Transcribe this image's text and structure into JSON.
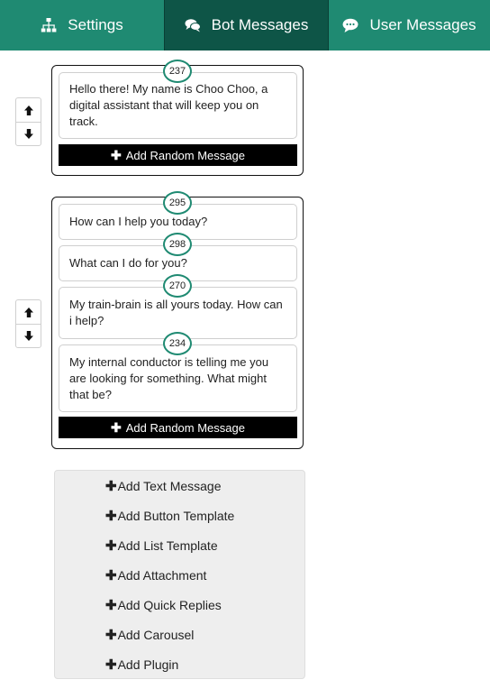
{
  "tabs": [
    {
      "label": "Settings",
      "icon": "sitemap-icon"
    },
    {
      "label": "Bot Messages",
      "icon": "comments-icon"
    },
    {
      "label": "User Messages",
      "icon": "comment-icon"
    }
  ],
  "active_tab": "Bot Messages",
  "groups": [
    {
      "messages": [
        {
          "id": "237",
          "text": "Hello there! My name is Choo Choo, a digital assistant that will keep you on track."
        }
      ],
      "add_random_label": "Add Random Message"
    },
    {
      "messages": [
        {
          "id": "295",
          "text": "How can I help you today?"
        },
        {
          "id": "298",
          "text": "What can I do for you?"
        },
        {
          "id": "270",
          "text": "My train-brain is all yours today. How can i help?"
        },
        {
          "id": "234",
          "text": "My internal conductor is telling me you are looking for something. What might that be?"
        }
      ],
      "add_random_label": "Add Random Message"
    }
  ],
  "add_menu": {
    "items": [
      "Add Text Message",
      "Add Button Template",
      "Add List Template",
      "Add Attachment",
      "Add Quick Replies",
      "Add Carousel",
      "Add Plugin"
    ]
  },
  "colors": {
    "tab": "#1f8a72",
    "tab_active": "#0e5547",
    "badge_border": "#1f8a72"
  }
}
